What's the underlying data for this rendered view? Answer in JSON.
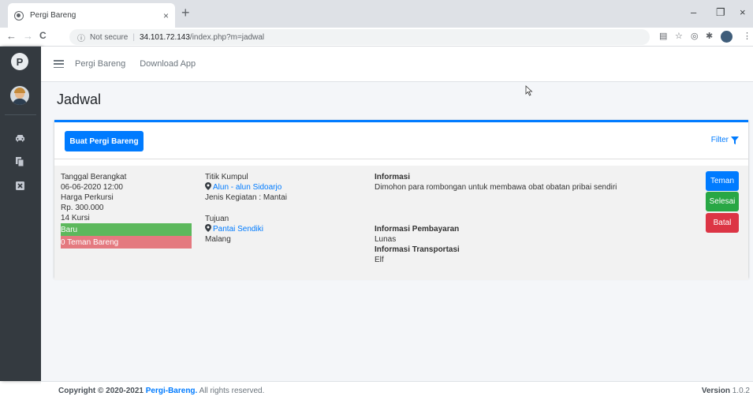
{
  "browser": {
    "tab_title": "Pergi Bareng",
    "tab_close": "×",
    "new_tab": "+",
    "minimize": "–",
    "restore": "❐",
    "close": "×",
    "back": "←",
    "forward": "→",
    "reload": "C",
    "not_secure": "Not secure",
    "separator": "|",
    "url_host": "34.101.72.143",
    "url_path": "/index.php?m=jadwal",
    "profile_initials": ""
  },
  "sidebar": {
    "brand_letter": "P",
    "icons": [
      "car-icon",
      "copy-icon",
      "close-box-icon"
    ]
  },
  "navbar": {
    "links": [
      "Pergi Bareng",
      "Download App"
    ]
  },
  "page": {
    "title": "Jadwal"
  },
  "toolbar": {
    "create_label": "Buat Pergi Bareng",
    "filter_label": "Filter"
  },
  "trip": {
    "departure_label": "Tanggal Berangkat",
    "departure_value": "06-06-2020 12:00",
    "price_label": "Harga Perkursi",
    "price_value": "Rp. 300.000",
    "seats": "14 Kursi",
    "status": "Baru",
    "friends": "0 Teman Bareng",
    "meeting_label": "Titik Kumpul",
    "meeting_place": "Alun - alun Sidoarjo",
    "activity": "Jenis Kegiatan : Mantai",
    "destination_label": "Tujuan",
    "destination_place": "Pantai Sendiki",
    "destination_city": "Malang",
    "info_label": "Informasi",
    "info_text": "Dimohon para rombongan untuk membawa obat obatan pribai sendiri",
    "payment_label": "Informasi Pembayaran",
    "payment_value": "Lunas",
    "transport_label": "Informasi Transportasi",
    "transport_value": "Elf",
    "btn_friends": "Teman",
    "btn_done": "Selesai",
    "btn_cancel": "Batal"
  },
  "colors": {
    "primary": "#007bff",
    "success": "#28a745",
    "danger": "#dc3545",
    "sidebar": "#343a40"
  },
  "footer": {
    "copyright_prefix": "Copyright © 2020-2021",
    "brand": "Pergi-Bareng.",
    "suffix": "All rights reserved.",
    "version_label": "Version",
    "version_value": "1.0.2"
  }
}
